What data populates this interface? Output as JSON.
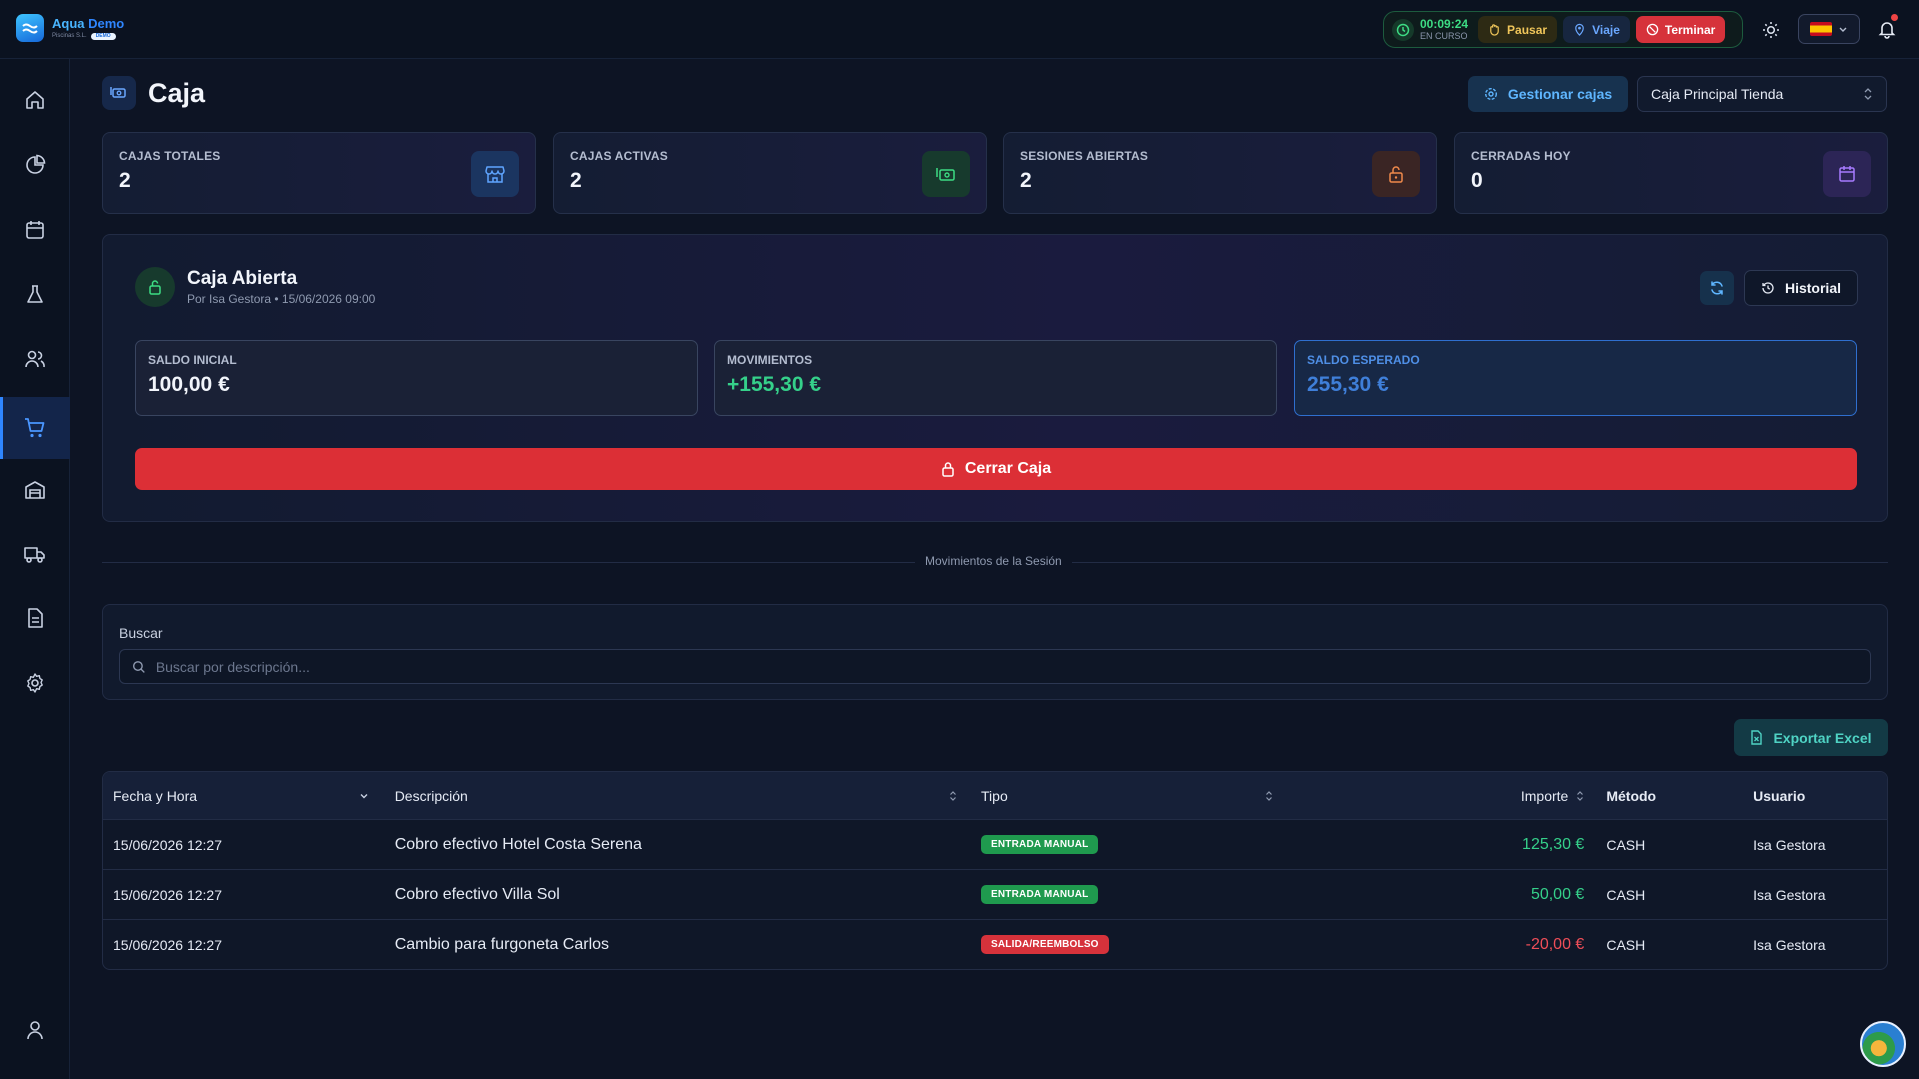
{
  "brand": {
    "name_a": "Aqua",
    "name_b": "Demo",
    "subtitle": "Piscinas S.L.",
    "badge": "DEMO"
  },
  "timer": {
    "time": "00:09:24",
    "status": "EN CURSO",
    "pause": "Pausar",
    "trip": "Viaje",
    "end": "Terminar"
  },
  "header": {
    "title": "Caja",
    "manage": "Gestionar cajas",
    "register": "Caja Principal Tienda"
  },
  "stats": [
    {
      "label": "CAJAS TOTALES",
      "value": "2",
      "icon": "store-icon",
      "color": "#5fa5ff"
    },
    {
      "label": "CAJAS ACTIVAS",
      "value": "2",
      "icon": "cash-icon",
      "color": "#3ddc84"
    },
    {
      "label": "SESIONES ABIERTAS",
      "value": "2",
      "icon": "unlock-icon",
      "color": "#f08a4b"
    },
    {
      "label": "CERRADAS HOY",
      "value": "0",
      "icon": "calendar-icon",
      "color": "#a77bff"
    }
  ],
  "session": {
    "title": "Caja Abierta",
    "subtitle": "Por Isa Gestora • 15/06/2026 09:00",
    "history": "Historial",
    "initial_label": "SALDO INICIAL",
    "initial_value": "100,00 €",
    "movements_label": "MOVIMIENTOS",
    "movements_value": "+155,30 €",
    "expected_label": "SALDO ESPERADO",
    "expected_value": "255,30 €",
    "close": "Cerrar Caja"
  },
  "divider": "Movimientos de la Sesión",
  "search": {
    "label": "Buscar",
    "placeholder": "Buscar por descripción..."
  },
  "export": "Exportar Excel",
  "table": {
    "headers": {
      "date": "Fecha y Hora",
      "desc": "Descripción",
      "type": "Tipo",
      "amount": "Importe",
      "method": "Método",
      "user": "Usuario"
    },
    "rows": [
      {
        "date": "15/06/2026 12:27",
        "desc": "Cobro efectivo Hotel Costa Serena",
        "type": "ENTRADA MANUAL",
        "kind": "in",
        "amount": "125,30 €",
        "method": "CASH",
        "user": "Isa Gestora"
      },
      {
        "date": "15/06/2026 12:27",
        "desc": "Cobro efectivo Villa Sol",
        "type": "ENTRADA MANUAL",
        "kind": "in",
        "amount": "50,00 €",
        "method": "CASH",
        "user": "Isa Gestora"
      },
      {
        "date": "15/06/2026 12:27",
        "desc": "Cambio para furgoneta Carlos",
        "type": "SALIDA/REEMBOLSO",
        "kind": "out",
        "amount": "-20,00 €",
        "method": "CASH",
        "user": "Isa Gestora"
      }
    ]
  }
}
